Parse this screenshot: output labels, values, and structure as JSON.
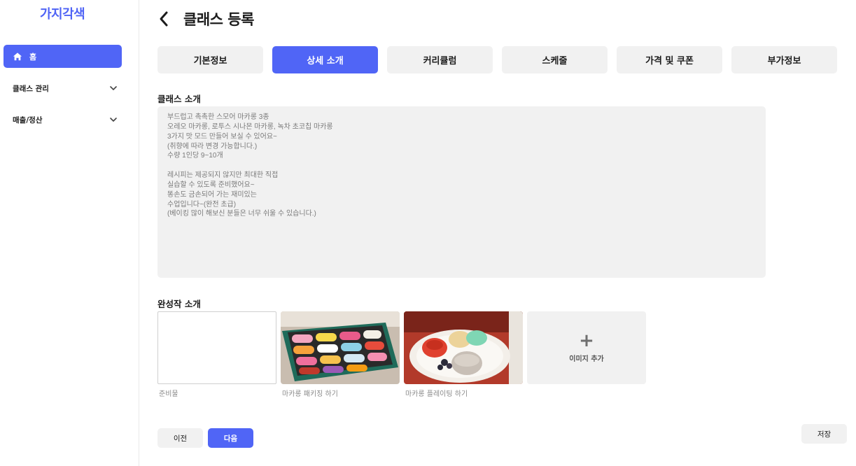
{
  "sidebar": {
    "logo": "가지각색",
    "home": {
      "label": "홈",
      "icon": "home-icon"
    },
    "items": [
      {
        "label": "클래스 관리",
        "icon": "chevron-down-icon"
      },
      {
        "label": "매출/정산",
        "icon": "chevron-down-icon"
      }
    ]
  },
  "header": {
    "title": "클래스 등록",
    "back_icon": "chevron-left-icon"
  },
  "tabs": [
    {
      "label": "기본정보",
      "active": false
    },
    {
      "label": "상세 소개",
      "active": true
    },
    {
      "label": "커리큘럼",
      "active": false
    },
    {
      "label": "스케줄",
      "active": false
    },
    {
      "label": "가격 및 쿠폰",
      "active": false
    },
    {
      "label": "부가정보",
      "active": false
    }
  ],
  "description": {
    "title": "클래스 소개",
    "text": "부드럽고 촉촉한 스모어 마카롱 3종\n오레오 마카롱, 로투스 시나몬 마카롱, 녹차 초코칩 마카롱\n3가지 맛 모드 만들어 보실 수 있어요~\n(취향에 따라 변경 가능합니다.)\n수량 1인당 9~10개\n\n레시피는 제공되지 않지만 최대한 직접\n실습할 수 있도록 준비했어요~\n똥손도 금손되어 가는 재미있는\n수업입니다~(완전 초급)\n(베이킹 많이 해보신 분들은 너무 쉬울 수 있습니다.)"
  },
  "gallery": {
    "title": "완성작 소개",
    "items": [
      {
        "caption": "준비물"
      },
      {
        "caption": "마카롱 패키징 하기"
      },
      {
        "caption": "마카롱 플레이팅 하기"
      }
    ],
    "add": {
      "label": "이미지 추가",
      "plus": "+"
    }
  },
  "buttons": {
    "prev": "이전",
    "next": "다음",
    "save": "저장"
  },
  "colors": {
    "accent": "#5065f6",
    "surface": "#f1f1f1"
  }
}
